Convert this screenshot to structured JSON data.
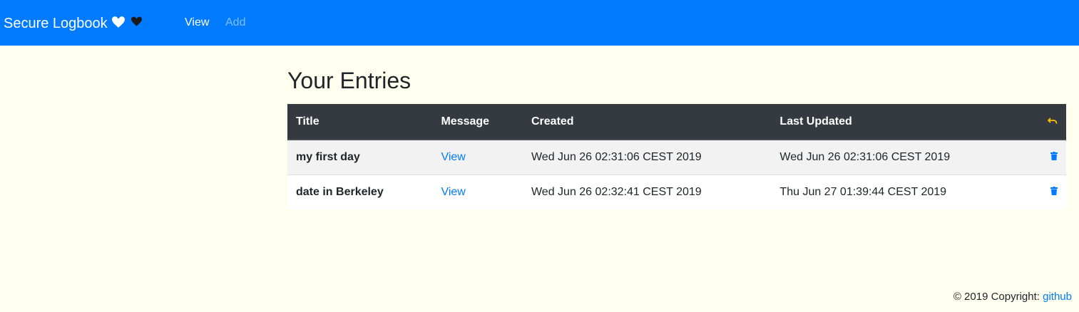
{
  "navbar": {
    "brand": "Secure Logbook",
    "links": {
      "view": "View",
      "add": "Add"
    },
    "color": "#007bff"
  },
  "main": {
    "heading": "Your Entries",
    "table": {
      "headers": {
        "title": "Title",
        "message": "Message",
        "created": "Created",
        "updated": "Last Updated"
      },
      "rows": [
        {
          "title": "my first day",
          "message": "View",
          "created": "Wed Jun 26 02:31:06 CEST 2019",
          "updated": "Wed Jun 26 02:31:06 CEST 2019"
        },
        {
          "title": "date in Berkeley",
          "message": "View",
          "created": "Wed Jun 26 02:32:41 CEST 2019",
          "updated": "Thu Jun 27 01:39:44 CEST 2019"
        }
      ]
    }
  },
  "footer": {
    "copyright": "© 2019 Copyright: ",
    "link": "github"
  },
  "icons": {
    "brand_heart": "heart-icon",
    "nav_heart": "heart-icon",
    "undo": "undo-icon",
    "delete": "trash-icon"
  }
}
